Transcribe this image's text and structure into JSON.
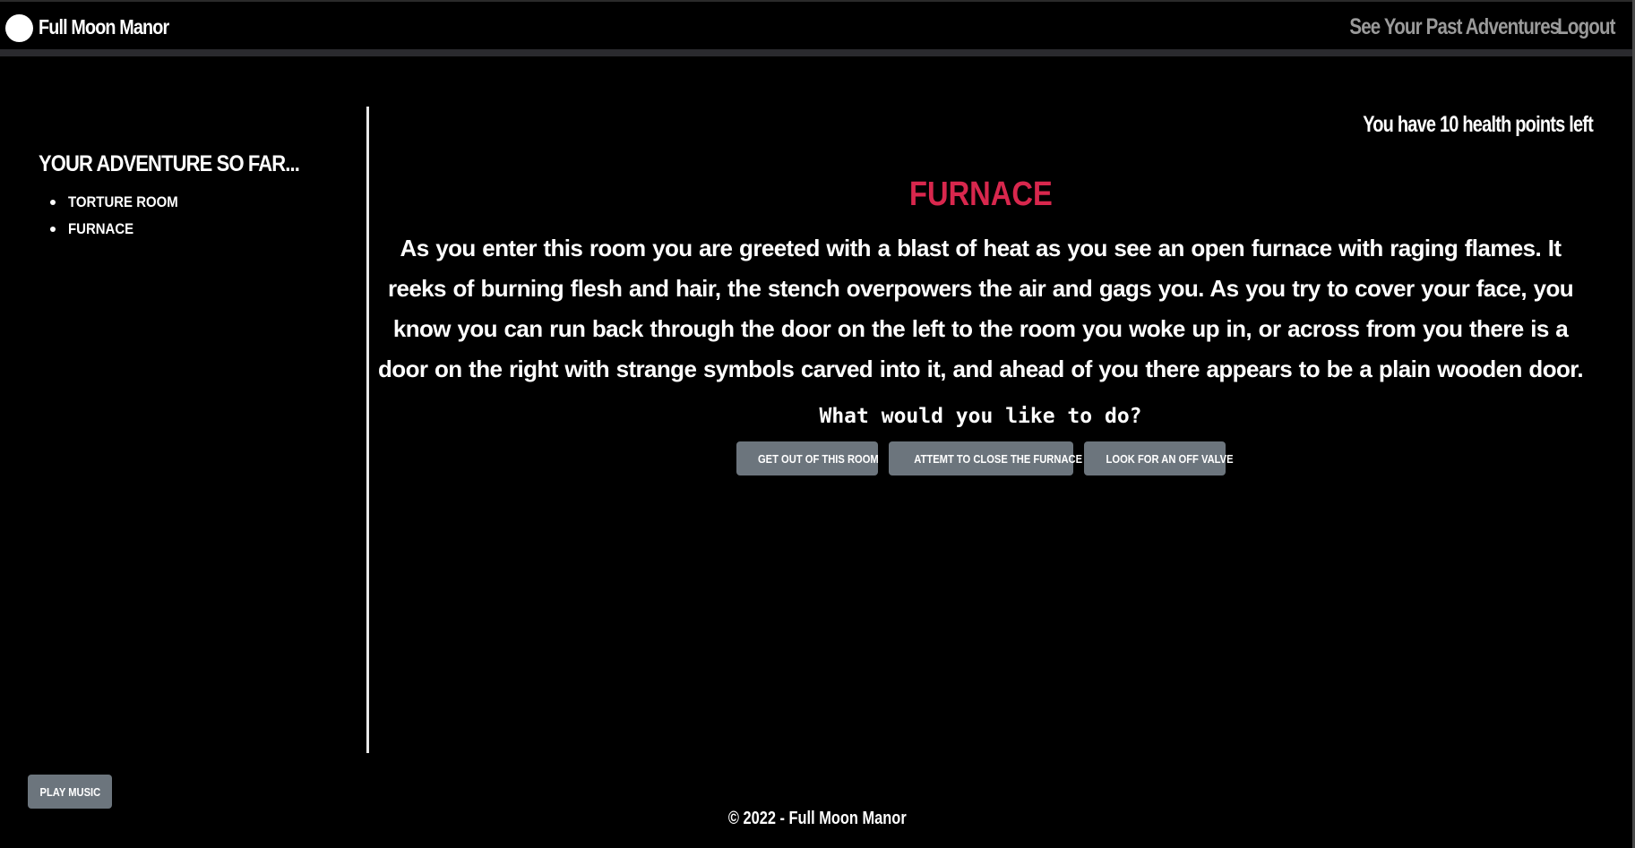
{
  "navbar": {
    "brand": "Full Moon Manor",
    "links": [
      "See Your Past Adventures",
      "Logout"
    ]
  },
  "sidebar": {
    "title": "Your Adventure So Far...",
    "rooms": [
      "Torture Room",
      "Furnace"
    ]
  },
  "main": {
    "health": "You have 10 health points left",
    "room_title": "Furnace",
    "description": "As you enter this room you are greeted with a blast of heat as you see an open furnace with raging flames. It reeks of burning flesh and hair, the stench overpowers the air and gags you. As you try to cover your face, you know you can run back through the door on the left to the room you woke up in, or across from you there is a door on the right with strange symbols carved into it, and ahead of you there appears to be a plain wooden door.",
    "question": "What would you like to do?",
    "choices": [
      "Get out of this room",
      "Attemt to close the furnace",
      "Look for an off valve"
    ]
  },
  "music_button": "Play Music",
  "footer": "© 2022 - Full Moon Manor",
  "colors": {
    "background": "#000000",
    "room_title": "#d8274d",
    "button": "#6c757d",
    "nav_link": "#9a9a9a"
  }
}
